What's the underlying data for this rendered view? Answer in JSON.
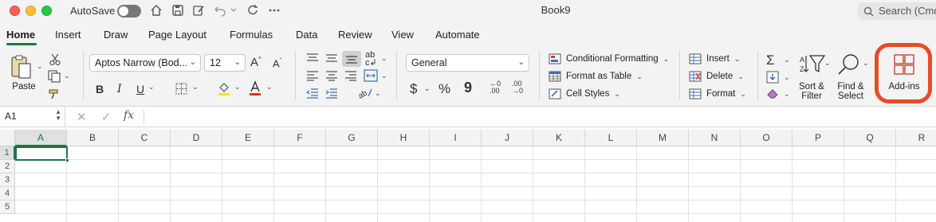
{
  "titlebar": {
    "autosave_label": "AutoSave",
    "doc_title": "Book9",
    "search_placeholder": "Search (Cmd"
  },
  "tabs": [
    "Home",
    "Insert",
    "Draw",
    "Page Layout",
    "Formulas",
    "Data",
    "Review",
    "View",
    "Automate"
  ],
  "active_tab": "Home",
  "ribbon": {
    "paste_label": "Paste",
    "font_name": "Aptos Narrow (Bod...",
    "font_size": "12",
    "bold": "B",
    "italic": "I",
    "underline": "U",
    "number_format": "General",
    "currency": "$",
    "percent": "%",
    "comma": "9",
    "conditional_formatting": "Conditional Formatting",
    "format_as_table": "Format as Table",
    "cell_styles": "Cell Styles",
    "insert": "Insert",
    "delete": "Delete",
    "format": "Format",
    "sort_filter_line1": "Sort &",
    "sort_filter_line2": "Filter",
    "find_select_line1": "Find &",
    "find_select_line2": "Select",
    "add_ins": "Add-ins",
    "highlight_color": "#e84b28",
    "accent_color": "#217346"
  },
  "formula_bar": {
    "name_box": "A1",
    "fx": "fx",
    "cancel": "✕",
    "enter": "✓",
    "content": ""
  },
  "grid": {
    "columns": [
      "A",
      "B",
      "C",
      "D",
      "E",
      "F",
      "G",
      "H",
      "I",
      "J",
      "K",
      "L",
      "M",
      "N",
      "O",
      "P",
      "Q",
      "R"
    ],
    "rows": [
      "1",
      "2",
      "3",
      "4",
      "5"
    ],
    "selected_cell": "A1"
  }
}
